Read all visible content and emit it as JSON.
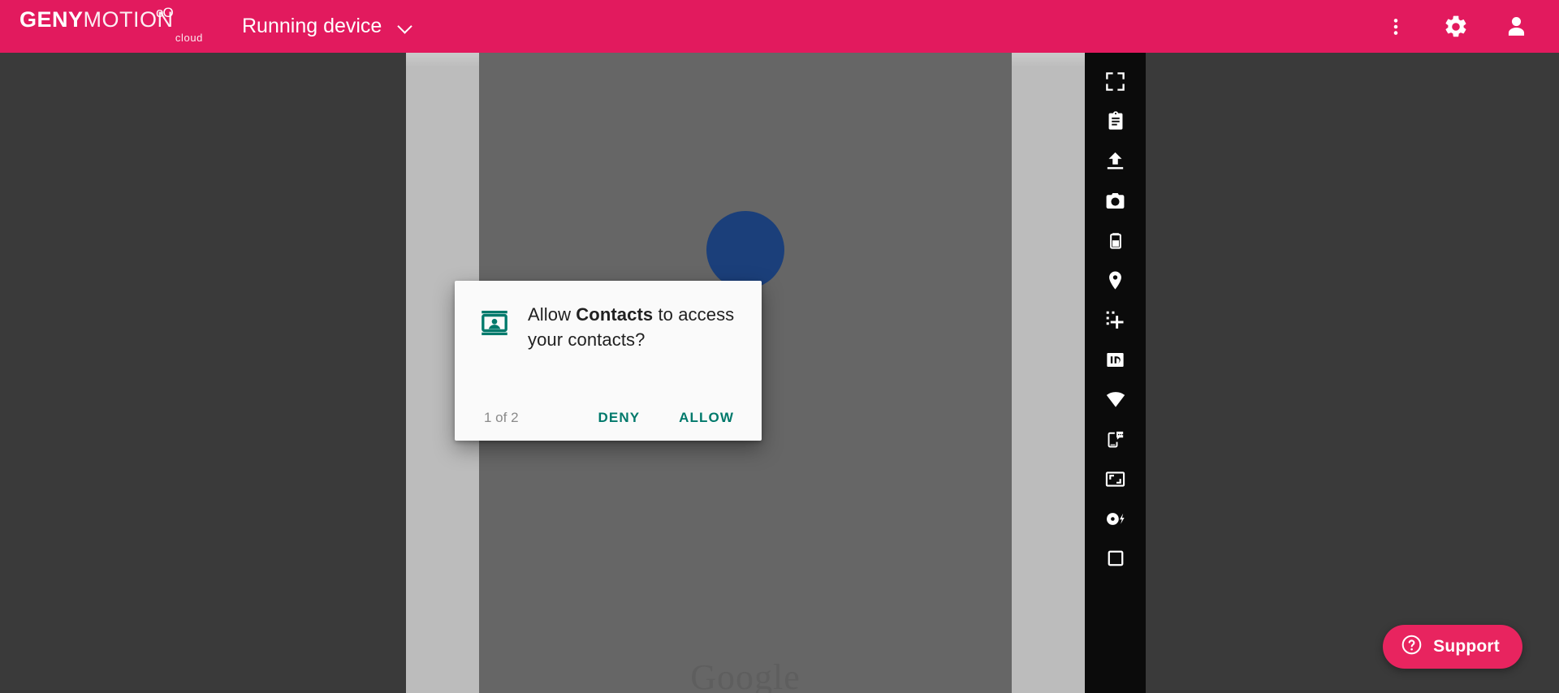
{
  "app": {
    "brand_primary": "GENY",
    "brand_secondary": "MOTION",
    "brand_dots": "oO",
    "brand_sub": "cloud",
    "header_color": "#e21a5e",
    "accent_color": "#e8245f"
  },
  "header": {
    "device_selector_label": "Running device",
    "device_selector_icon": "chevron-down-icon",
    "actions": [
      {
        "name": "more-options-icon",
        "label": "More options"
      },
      {
        "name": "settings-gear-icon",
        "label": "Settings"
      },
      {
        "name": "account-person-icon",
        "label": "Account"
      }
    ]
  },
  "device": {
    "screen_background": "#666666",
    "frame_background": "#bcbcbc",
    "stage_background": "#3a3a3a",
    "splash_circle_color": "#1b3f7a",
    "splash_wordmark": "Google"
  },
  "dialog": {
    "icon": "contacts-card-icon",
    "icon_color": "#00796b",
    "message_prefix": "Allow ",
    "message_app": "Contacts",
    "message_suffix": " to access your contacts?",
    "counter": "1 of 2",
    "deny_label": "DENY",
    "allow_label": "ALLOW",
    "action_color": "#00796b"
  },
  "toolbar": {
    "items": [
      {
        "name": "fullscreen-icon",
        "label": "Fullscreen"
      },
      {
        "name": "clipboard-icon",
        "label": "Clipboard"
      },
      {
        "name": "upload-icon",
        "label": "Upload file"
      },
      {
        "name": "camera-icon",
        "label": "Camera"
      },
      {
        "name": "battery-icon",
        "label": "Battery"
      },
      {
        "name": "location-pin-icon",
        "label": "GPS"
      },
      {
        "name": "multitouch-plus-icon",
        "label": "Multi-touch"
      },
      {
        "name": "identifiers-id-icon",
        "label": "Identifiers"
      },
      {
        "name": "network-wifi-icon",
        "label": "Network"
      },
      {
        "name": "phone-sms-icon",
        "label": "Phone / SMS"
      },
      {
        "name": "screen-resize-icon",
        "label": "Display"
      },
      {
        "name": "baseband-disk-icon",
        "label": "Baseband"
      },
      {
        "name": "recents-square-icon",
        "label": "Recents"
      }
    ]
  },
  "support": {
    "icon": "question-circle-icon",
    "label": "Support"
  }
}
